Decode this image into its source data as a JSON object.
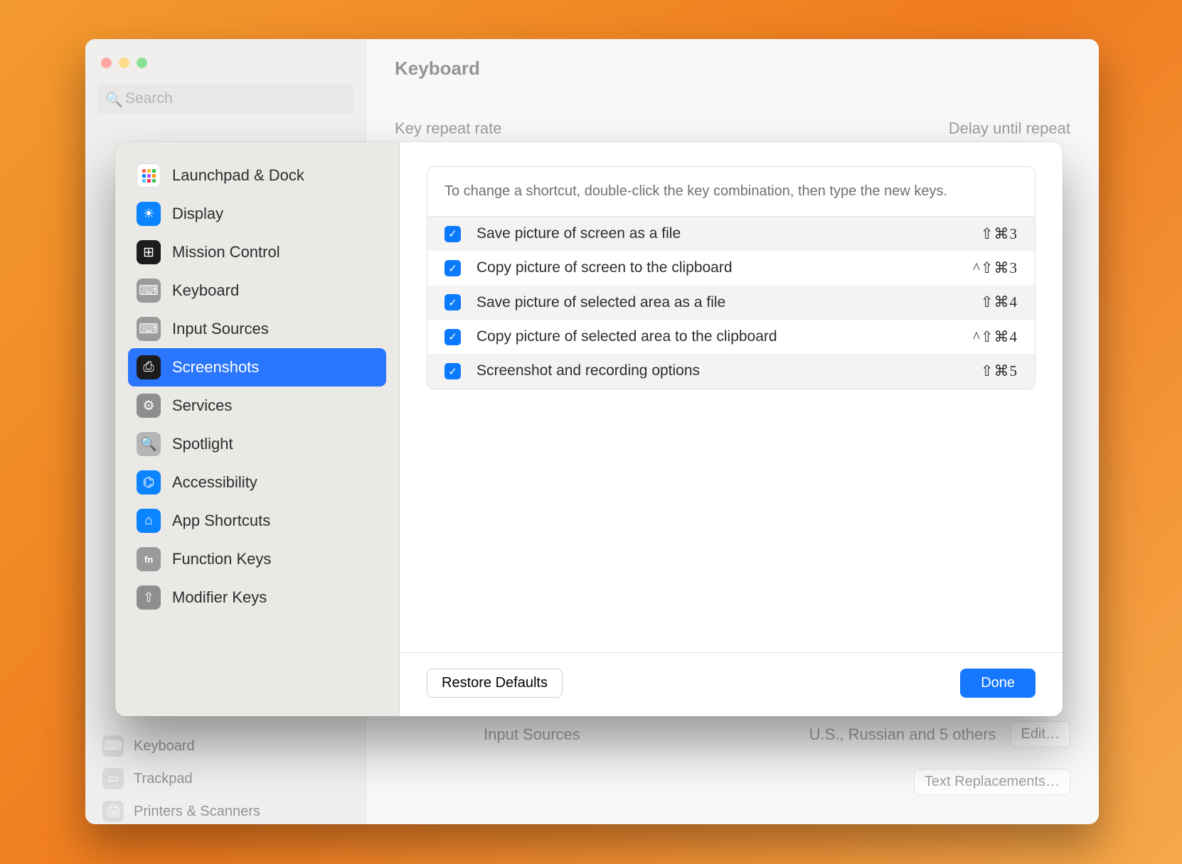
{
  "parent": {
    "title": "Keyboard",
    "search_placeholder": "Search",
    "dim_labels": {
      "left": "Key repeat rate",
      "right": "Delay until repeat"
    },
    "below": {
      "input_sources_label": "Input Sources",
      "input_sources_value": "U.S., Russian and 5 others",
      "edit_label": "Edit…",
      "text_replacements_label": "Text Replacements…"
    },
    "sidebar_hidden": [
      "Keyboard",
      "Trackpad",
      "Printers & Scanners"
    ]
  },
  "sheet": {
    "categories": [
      {
        "id": "launchpad",
        "label": "Launchpad & Dock"
      },
      {
        "id": "display",
        "label": "Display"
      },
      {
        "id": "mission",
        "label": "Mission Control"
      },
      {
        "id": "keyboard",
        "label": "Keyboard"
      },
      {
        "id": "input",
        "label": "Input Sources"
      },
      {
        "id": "screenshots",
        "label": "Screenshots",
        "selected": true
      },
      {
        "id": "services",
        "label": "Services"
      },
      {
        "id": "spotlight",
        "label": "Spotlight"
      },
      {
        "id": "accessibility",
        "label": "Accessibility"
      },
      {
        "id": "appsc",
        "label": "App Shortcuts"
      },
      {
        "id": "fn",
        "label": "Function Keys"
      },
      {
        "id": "modifier",
        "label": "Modifier Keys"
      }
    ],
    "help": "To change a shortcut, double-click the key combination, then type the new keys.",
    "shortcuts": [
      {
        "checked": true,
        "label": "Save picture of screen as a file",
        "keys": "⇧⌘3"
      },
      {
        "checked": true,
        "label": "Copy picture of screen to the clipboard",
        "keys": "^⇧⌘3"
      },
      {
        "checked": true,
        "label": "Save picture of selected area as a file",
        "keys": "⇧⌘4"
      },
      {
        "checked": true,
        "label": "Copy picture of selected area to the clipboard",
        "keys": "^⇧⌘4"
      },
      {
        "checked": true,
        "label": "Screenshot and recording options",
        "keys": "⇧⌘5"
      }
    ],
    "footer": {
      "restore": "Restore Defaults",
      "done": "Done"
    }
  }
}
